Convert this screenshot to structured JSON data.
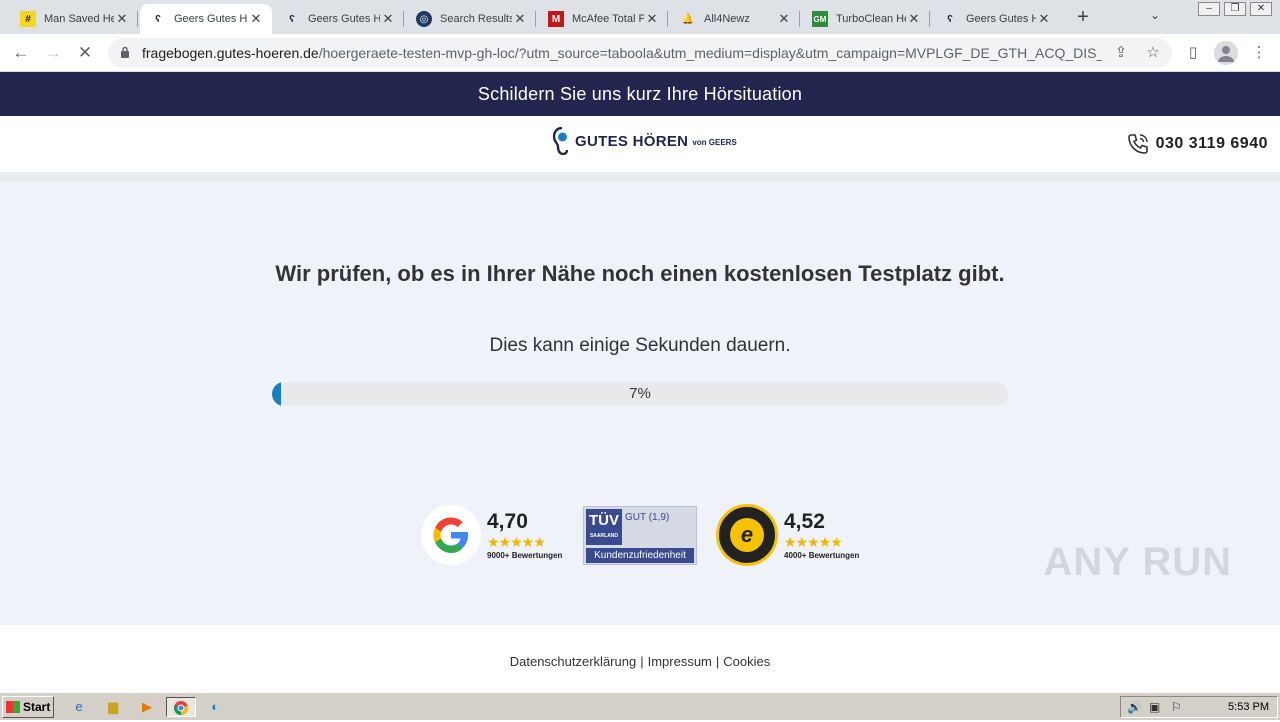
{
  "browser": {
    "tabs": [
      {
        "title": "Man Saved He",
        "favicon": "hash-icon",
        "active": false
      },
      {
        "title": "Geers Gutes H",
        "favicon": "ear-icon",
        "active": true
      },
      {
        "title": "Geers Gutes H",
        "favicon": "ear-icon",
        "active": false
      },
      {
        "title": "Search Results",
        "favicon": "globe-icon",
        "active": false
      },
      {
        "title": "McAfee Total P",
        "favicon": "mcafee-icon",
        "active": false
      },
      {
        "title": "All4Newz",
        "favicon": "bell-icon",
        "active": false
      },
      {
        "title": "TurboClean He",
        "favicon": "gm-icon",
        "active": false
      },
      {
        "title": "Geers Gutes H",
        "favicon": "ear-icon",
        "active": false
      }
    ],
    "url_host": "fragebogen.gutes-hoeren.de",
    "url_path": "/hoergeraete-testen-mvp-gh-loc/?utm_source=taboola&utm_medium=display&utm_campaign=MVPLGF_DE_GTH_ACQ_DIS_..."
  },
  "page": {
    "banner": "Schildern Sie uns kurz Ihre Hörsituation",
    "logo": {
      "brand": "GUTES HÖREN",
      "sub": "von GEERS"
    },
    "phone": "030 3119 6940",
    "headline": "Wir prüfen, ob es in Ihrer Nähe noch einen kostenlosen Testplatz gibt.",
    "subline": "Dies kann einige Sekunden dauern.",
    "progress": {
      "value": 0.07,
      "label": "7%"
    },
    "badges": {
      "google": {
        "score": "4,70",
        "stars": "★★★★★",
        "count": "9000+ Bewertungen"
      },
      "tuv": {
        "mark": "TÜV SAARLAND",
        "grade": "GUT (1,9)",
        "label": "Kundenzufriedenheit"
      },
      "trusted_shops": {
        "score": "4,52",
        "stars": "★★★★★",
        "count": "4000+ Bewertungen"
      }
    },
    "footer": {
      "links": [
        "Datenschutzerklärung",
        "Impressum",
        "Cookies"
      ]
    },
    "accent_color": "#22264e",
    "progress_color": "#1a7fc1"
  },
  "taskbar": {
    "start_label": "Start",
    "time": "5:53 PM"
  },
  "watermark": "ANY RUN"
}
